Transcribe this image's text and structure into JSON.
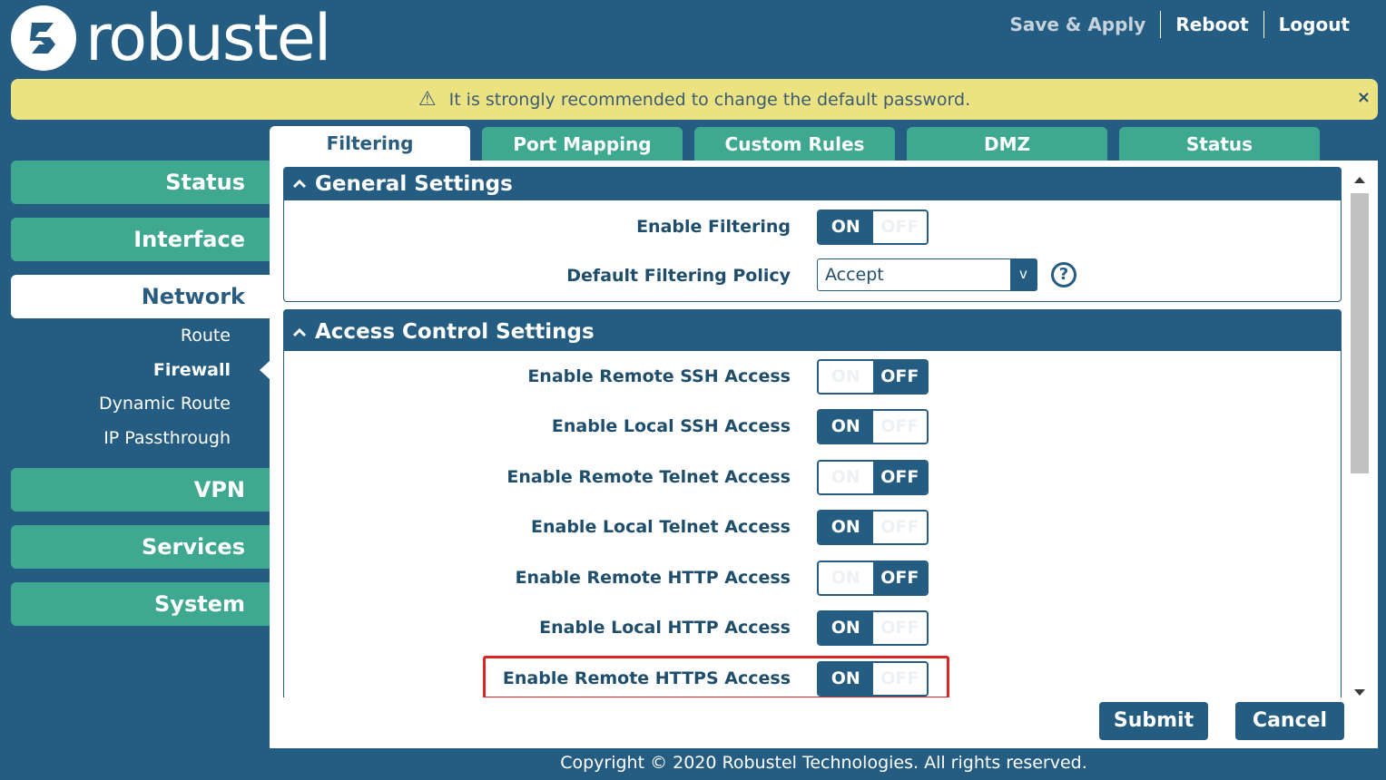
{
  "brand": {
    "name": "robustel",
    "logo_icon": "robustel-logo-icon"
  },
  "header": {
    "links": [
      {
        "label": "Save & Apply",
        "muted": true
      },
      {
        "label": "Reboot",
        "muted": false
      },
      {
        "label": "Logout",
        "muted": false
      }
    ]
  },
  "banner": {
    "icon": "warning-icon",
    "text": "It is strongly recommended to change the default password.",
    "close": "×"
  },
  "sidebar": {
    "items": [
      {
        "label": "Status"
      },
      {
        "label": "Interface"
      },
      {
        "label": "Network",
        "active": true
      },
      {
        "label": "VPN"
      },
      {
        "label": "Services"
      },
      {
        "label": "System"
      }
    ],
    "sub_items": [
      {
        "label": "Route"
      },
      {
        "label": "Firewall",
        "current": true
      },
      {
        "label": "Dynamic Route"
      },
      {
        "label": "IP Passthrough"
      }
    ]
  },
  "tabs": [
    {
      "label": "Filtering",
      "active": true
    },
    {
      "label": "Port Mapping"
    },
    {
      "label": "Custom Rules"
    },
    {
      "label": "DMZ"
    },
    {
      "label": "Status"
    }
  ],
  "general": {
    "title": "General Settings",
    "enable_filtering": {
      "label": "Enable Filtering",
      "on": "ON",
      "off": "OFF",
      "state": "on"
    },
    "default_policy": {
      "label": "Default Filtering Policy",
      "value": "Accept",
      "caret": "v",
      "help": "?"
    }
  },
  "access": {
    "title": "Access Control Settings",
    "rows": [
      {
        "label": "Enable Remote SSH Access",
        "on": "ON",
        "off": "OFF",
        "state": "off"
      },
      {
        "label": "Enable Local SSH Access",
        "on": "ON",
        "off": "OFF",
        "state": "on"
      },
      {
        "label": "Enable Remote Telnet Access",
        "on": "ON",
        "off": "OFF",
        "state": "off"
      },
      {
        "label": "Enable Local Telnet Access",
        "on": "ON",
        "off": "OFF",
        "state": "on"
      },
      {
        "label": "Enable Remote HTTP Access",
        "on": "ON",
        "off": "OFF",
        "state": "off"
      },
      {
        "label": "Enable Local HTTP Access",
        "on": "ON",
        "off": "OFF",
        "state": "on"
      },
      {
        "label": "Enable Remote HTTPS Access",
        "on": "ON",
        "off": "OFF",
        "state": "on"
      }
    ]
  },
  "buttons": {
    "submit": "Submit",
    "cancel": "Cancel"
  },
  "footer": {
    "copyright": "Copyright © 2020 Robustel Technologies. All rights reserved."
  },
  "colors": {
    "navy": "#255d82",
    "teal": "#3ea890",
    "banner": "#ede282",
    "highlight": "#e02424"
  }
}
